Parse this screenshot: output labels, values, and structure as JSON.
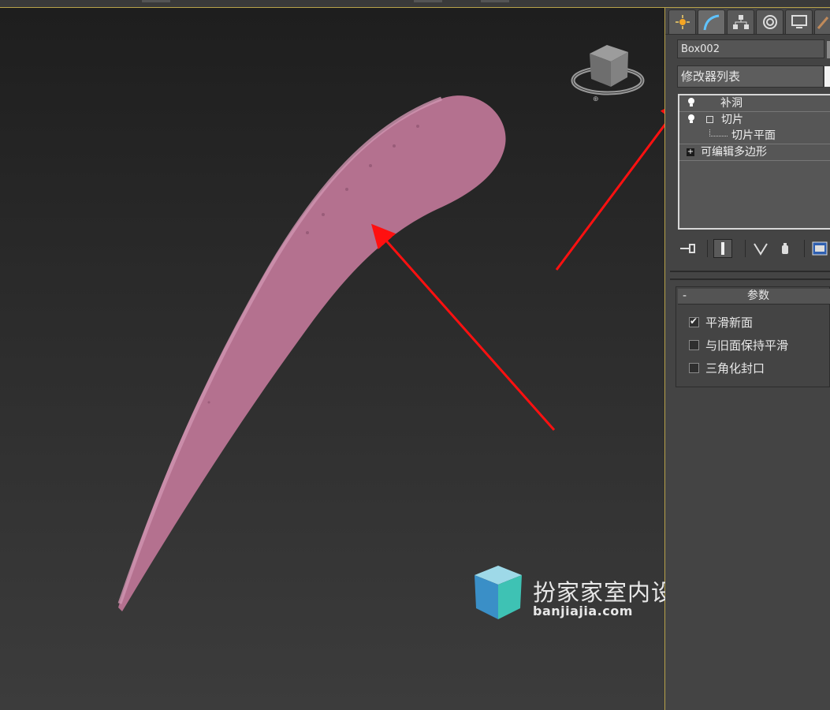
{
  "panel": {
    "object_name": "Box002",
    "modifier_list_label": "修改器列表",
    "stack_items": [
      {
        "label": "补洞"
      },
      {
        "label": "切片"
      },
      {
        "label": "切片平面"
      },
      {
        "label": "可编辑多边形"
      }
    ],
    "rollout": {
      "toggle": "-",
      "title": "参数",
      "options": [
        {
          "label": "平滑新面",
          "checked": true
        },
        {
          "label": "与旧面保持平滑",
          "checked": false
        },
        {
          "label": "三角化封口",
          "checked": false
        }
      ]
    }
  },
  "watermark": {
    "title": "扮家家室内设计",
    "url": "banjiajia.com"
  },
  "colors": {
    "object_pink": "#b4718f",
    "arrow_red": "#ff1010",
    "frame_gold": "#b8a24a",
    "logo_blue": "#3a8fc7",
    "logo_teal": "#3ec2b4"
  }
}
